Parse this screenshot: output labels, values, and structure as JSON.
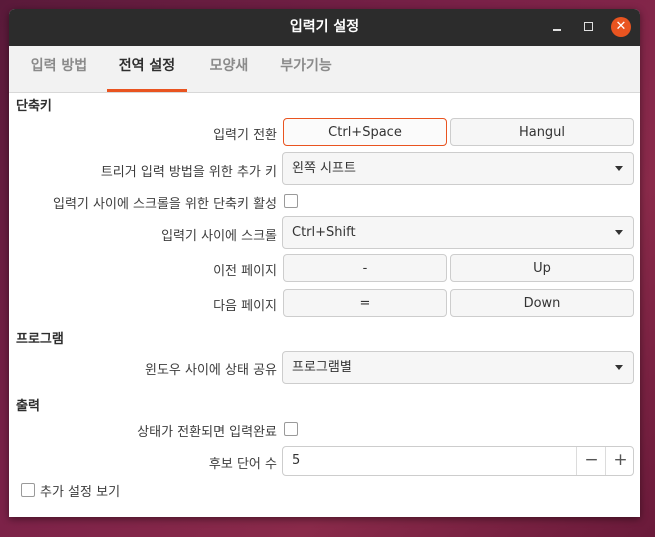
{
  "window": {
    "title": "입력기 설정"
  },
  "tabs": [
    {
      "label": "입력 방법"
    },
    {
      "label": "전역 설정"
    },
    {
      "label": "모양새"
    },
    {
      "label": "부가기능"
    }
  ],
  "shortcuts": {
    "section_title": "단축키",
    "trigger_label": "입력기 전환",
    "trigger_keys": [
      "Ctrl+Space",
      "Hangul"
    ],
    "extra_trigger_label": "트리거 입력 방법을 위한 추가 키",
    "extra_trigger_value": "왼쪽 시프트",
    "enum_hotkey_label": "입력기 사이에 스크롤을 위한 단축키 활성",
    "enum_hotkey_checked": false,
    "scroll_label": "입력기 사이에 스크롤",
    "scroll_value": "Ctrl+Shift",
    "prev_page_label": "이전 페이지",
    "prev_page_keys": [
      "-",
      "Up"
    ],
    "next_page_label": "다음 페이지",
    "next_page_keys": [
      "=",
      "Down"
    ]
  },
  "program": {
    "section_title": "프로그램",
    "share_state_label": "윈도우 사이에 상태 공유",
    "share_state_value": "프로그램별"
  },
  "output": {
    "section_title": "출력",
    "commit_on_switch_label": "상태가 전환되면 입력완료",
    "commit_on_switch_checked": false,
    "candidate_count_label": "후보 단어 수",
    "candidate_count_value": "5",
    "minus_symbol": "−",
    "plus_symbol": "+"
  },
  "advanced": {
    "label": "추가 설정 보기",
    "checked": false
  },
  "colors": {
    "accent": "#e95420",
    "titlebar": "#2c2c2c"
  }
}
